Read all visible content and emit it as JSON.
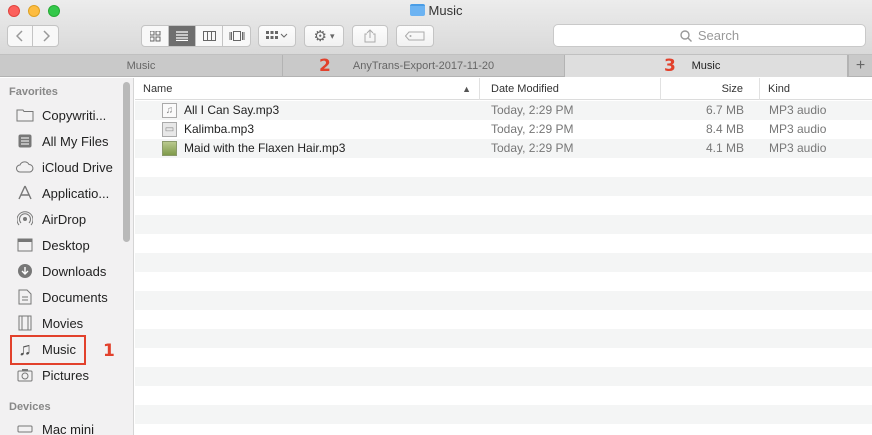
{
  "window": {
    "title": "Music"
  },
  "toolbar": {
    "search_placeholder": "Search",
    "search_icon": "magnifier-icon",
    "settings_icon": "gear-icon",
    "share_icon": "share-icon",
    "tag_icon": "tag-icon",
    "view_modes": [
      "icon-view",
      "list-view",
      "column-view",
      "cover-flow-view"
    ],
    "active_view": "list-view"
  },
  "tabs": [
    {
      "label": "Music",
      "active": false
    },
    {
      "label": "AnyTrans-Export-2017-11-20",
      "active": false
    },
    {
      "label": "Music",
      "active": true
    }
  ],
  "annotations": {
    "m1": "1",
    "m2": "2",
    "m3": "3",
    "color": "#e2412c"
  },
  "sidebar": {
    "favorites_heading": "Favorites",
    "devices_heading": "Devices",
    "items": [
      {
        "label": "Copywriti...",
        "icon": "folder-icon"
      },
      {
        "label": "All My Files",
        "icon": "all-files-icon"
      },
      {
        "label": "iCloud Drive",
        "icon": "cloud-icon"
      },
      {
        "label": "Applicatio...",
        "icon": "applications-icon"
      },
      {
        "label": "AirDrop",
        "icon": "airdrop-icon"
      },
      {
        "label": "Desktop",
        "icon": "desktop-icon"
      },
      {
        "label": "Downloads",
        "icon": "downloads-icon"
      },
      {
        "label": "Documents",
        "icon": "documents-icon"
      },
      {
        "label": "Movies",
        "icon": "movies-icon"
      },
      {
        "label": "Music",
        "icon": "music-icon"
      },
      {
        "label": "Pictures",
        "icon": "camera-icon"
      }
    ],
    "devices": [
      {
        "label": "Mac mini",
        "icon": "computer-icon"
      }
    ]
  },
  "columns": {
    "name": "Name",
    "date": "Date Modified",
    "size": "Size",
    "kind": "Kind"
  },
  "files": [
    {
      "name": "All I Can Say.mp3",
      "date": "Today, 2:29 PM",
      "size": "6.7 MB",
      "kind": "MP3 audio"
    },
    {
      "name": "Kalimba.mp3",
      "date": "Today, 2:29 PM",
      "size": "8.4 MB",
      "kind": "MP3 audio"
    },
    {
      "name": "Maid with the Flaxen Hair.mp3",
      "date": "Today, 2:29 PM",
      "size": "4.1 MB",
      "kind": "MP3 audio"
    }
  ]
}
